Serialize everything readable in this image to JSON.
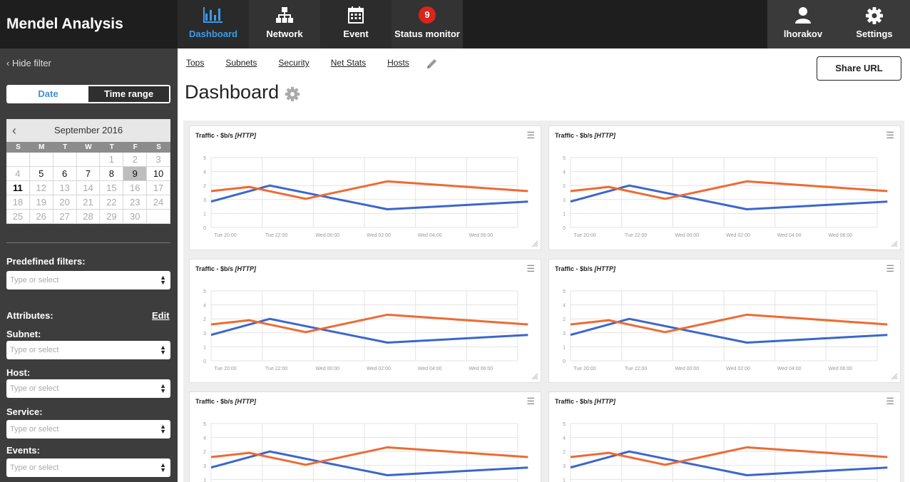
{
  "app": {
    "title": "Mendel Analysis"
  },
  "nav": {
    "items": [
      {
        "label": "Dashboard",
        "icon": "bar-chart-icon",
        "active": true
      },
      {
        "label": "Network",
        "icon": "sitemap-icon"
      },
      {
        "label": "Event",
        "icon": "calendar-icon"
      },
      {
        "label": "Status monitor",
        "badge": "9"
      }
    ],
    "user": {
      "label": "lhorakov",
      "icon": "user-icon"
    },
    "settings": {
      "label": "Settings",
      "icon": "gear-icon"
    }
  },
  "sidebar": {
    "hide_filter": "Hide filter",
    "toggle": {
      "date": "Date",
      "time_range": "Time range"
    },
    "calendar": {
      "month": "September 2016",
      "weekdays": [
        "S",
        "M",
        "T",
        "W",
        "T",
        "F",
        "S"
      ],
      "days": [
        "",
        "",
        "",
        "",
        "1",
        "2",
        "3",
        "4",
        "5",
        "6",
        "7",
        "8",
        "9",
        "10",
        "11",
        "12",
        "13",
        "14",
        "15",
        "16",
        "17",
        "18",
        "19",
        "20",
        "21",
        "22",
        "23",
        "24",
        "25",
        "26",
        "27",
        "28",
        "29",
        "30",
        ""
      ],
      "selected": "9",
      "today": "11"
    },
    "predefined_label": "Predefined filters:",
    "attributes_label": "Attributes:",
    "edit_label": "Edit",
    "placeholder": "Type or select",
    "fields": [
      {
        "label": "Subnet:"
      },
      {
        "label": "Host:"
      },
      {
        "label": "Service:"
      },
      {
        "label": "Events:"
      }
    ]
  },
  "main": {
    "tabs": [
      "Tops",
      "Subnets",
      "Security",
      "Net Stats",
      "Hosts"
    ],
    "share_label": "Share URL",
    "title": "Dashboard"
  },
  "colors": {
    "accent": "#3d9be9",
    "series_blue": "#3b66cc",
    "series_orange": "#ee6a31",
    "badge": "#d9251c"
  },
  "widgets": [
    {
      "title": "Traffic - $b/s",
      "title_tag": "[HTTP]"
    },
    {
      "title": "Traffic - $b/s",
      "title_tag": "[HTTP]"
    },
    {
      "title": "Traffic - $b/s",
      "title_tag": "[HTTP]"
    },
    {
      "title": "Traffic - $b/s",
      "title_tag": "[HTTP]"
    },
    {
      "title": "Traffic - $b/s",
      "title_tag": "[HTTP]"
    },
    {
      "title": "Traffic - $b/s",
      "title_tag": "[HTTP]"
    }
  ],
  "chart_data": {
    "type": "line",
    "x": [
      "Tue 20:00",
      "Tue 22:00",
      "Wed 00:00",
      "Wed 02:00",
      "Wed 04:00",
      "Wed 06:00"
    ],
    "y_ticks": [
      "0",
      "1",
      "3",
      "2",
      "4",
      "5"
    ],
    "ylim": [
      0,
      5
    ],
    "series": [
      {
        "color": "#3b66cc",
        "points": [
          [
            0,
            1.85
          ],
          [
            1.15,
            3.0
          ],
          [
            3.45,
            1.3
          ],
          [
            6.2,
            1.85
          ]
        ]
      },
      {
        "color": "#ee6a31",
        "points": [
          [
            0,
            2.6
          ],
          [
            0.75,
            2.9
          ],
          [
            1.85,
            2.05
          ],
          [
            3.45,
            3.3
          ],
          [
            6.2,
            2.6
          ]
        ]
      }
    ],
    "grid": true,
    "legend": "none"
  }
}
